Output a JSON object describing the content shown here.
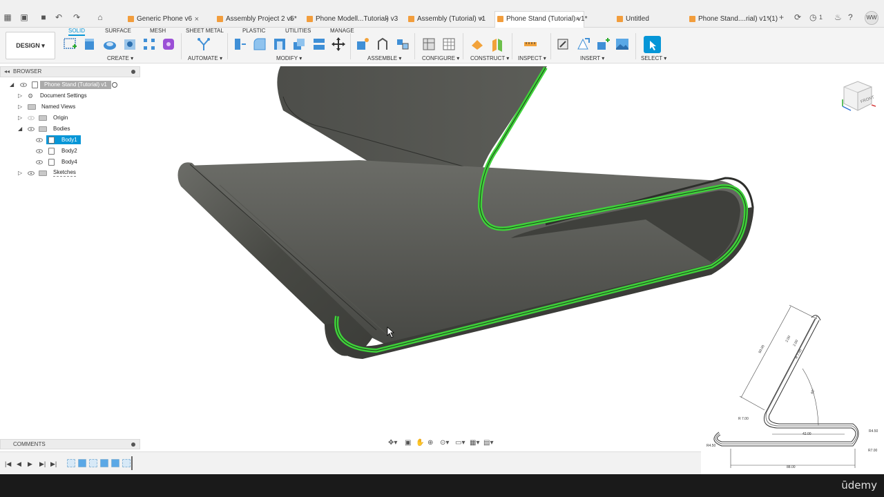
{
  "tabs": [
    {
      "label": "Generic Phone v6",
      "active": false
    },
    {
      "label": "Assembly Project 2 v5*",
      "active": false
    },
    {
      "label": "Phone Modell...Tutorial) v3",
      "active": false
    },
    {
      "label": "Assembly (Tutorial) v1",
      "active": false
    },
    {
      "label": "Phone Stand (Tutorial) v1*",
      "active": true
    },
    {
      "label": "Untitled",
      "active": false
    },
    {
      "label": "Phone Stand....rial) v1*(1)",
      "active": false
    }
  ],
  "topbar": {
    "notif_count": "1",
    "user_initials": "WW"
  },
  "ribbon": {
    "workspace": "DESIGN",
    "tabs": [
      "SOLID",
      "SURFACE",
      "MESH",
      "SHEET METAL",
      "PLASTIC",
      "UTILITIES",
      "MANAGE"
    ],
    "groups": [
      "CREATE",
      "AUTOMATE",
      "MODIFY",
      "ASSEMBLE",
      "CONFIGURE",
      "CONSTRUCT",
      "INSPECT",
      "INSERT",
      "SELECT"
    ]
  },
  "browser": {
    "title": "BROWSER",
    "root": "Phone Stand (Tutorial) v1",
    "items": [
      "Document Settings",
      "Named Views",
      "Origin",
      "Bodies",
      "Body1",
      "Body2",
      "Body4",
      "Sketches"
    ]
  },
  "comments": {
    "title": "COMMENTS"
  },
  "viewcube": {
    "face": "FRONT"
  },
  "drawing": {
    "dims": [
      "90.00",
      "2.00",
      "2.00",
      "R 7.00",
      "R 7.00",
      "42.00",
      "R4.50",
      "R4.50",
      "88.00",
      "R7.00",
      "65°"
    ]
  },
  "watermark": "ūdemy",
  "colors": {
    "accent": "#0696d7",
    "edge_highlight": "#3fd13a",
    "body": "#4b4d48"
  }
}
